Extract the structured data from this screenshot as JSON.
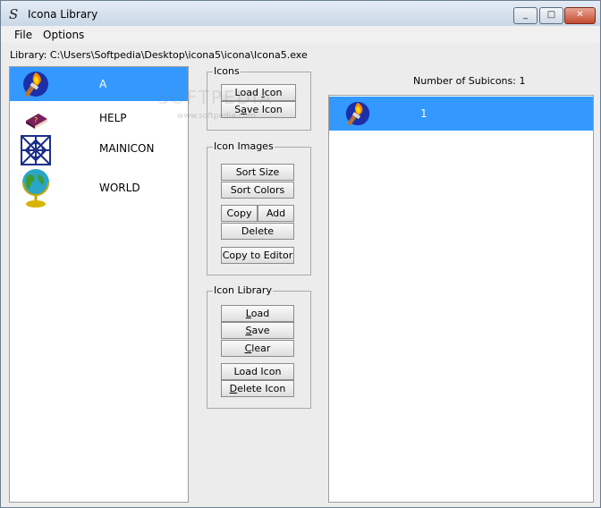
{
  "window": {
    "title": "Icona Library",
    "app_icon": "S",
    "minimize_icon": "_",
    "maximize_icon": "□",
    "close_icon": "✕"
  },
  "menu": {
    "file": "File",
    "options": "Options"
  },
  "library_path": "Library: C:\\Users\\Softpedia\\Desktop\\icona5\\icona\\Icona5.exe",
  "icon_list": [
    {
      "label": "A",
      "icon": "torch-icon",
      "selected": true
    },
    {
      "label": "HELP",
      "icon": "book-icon",
      "selected": false
    },
    {
      "label": "MAINICON",
      "icon": "pattern-icon",
      "selected": false
    },
    {
      "label": "WORLD",
      "icon": "globe-icon",
      "selected": false
    }
  ],
  "groups": {
    "icons": {
      "title": "Icons",
      "load": {
        "pre": "Load ",
        "acc": "I",
        "post": "con"
      },
      "save": {
        "pre": "S",
        "acc": "a",
        "post": "ve Icon"
      }
    },
    "icon_images": {
      "title": "Icon Images",
      "sort_size": "Sort Size",
      "sort_colors": "Sort Colors",
      "copy": "Copy",
      "add": "Add",
      "delete": "Delete",
      "copy_to_editor": "Copy to Editor"
    },
    "icon_library": {
      "title": "Icon Library",
      "load": {
        "acc": "L",
        "post": "oad"
      },
      "save": {
        "acc": "S",
        "post": "ave"
      },
      "clear": {
        "acc": "C",
        "post": "lear"
      },
      "load_icon": "Load Icon",
      "delete_icon": {
        "acc": "D",
        "post": "elete Icon"
      }
    }
  },
  "subicons": {
    "label": "Number of Subicons: 1",
    "items": [
      {
        "label": "1",
        "icon": "torch-icon"
      }
    ]
  },
  "watermark": {
    "main": "SOFTPEDIA",
    "sub": "www.softpedia.com"
  }
}
